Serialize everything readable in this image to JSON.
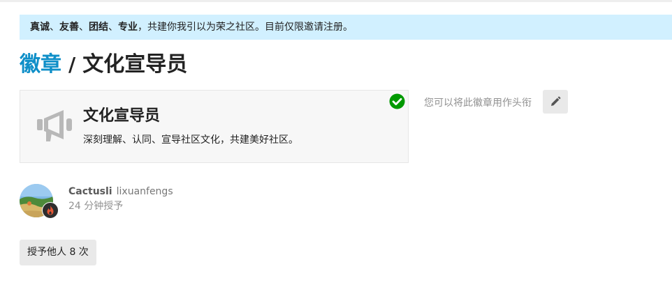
{
  "notice": {
    "values": [
      "真诚",
      "友善",
      "团结",
      "专业"
    ],
    "separator": "、",
    "suffix": "，共建你我引以为荣之社区。目前仅限邀请注册。"
  },
  "header": {
    "breadcrumb": "徽章",
    "separator": "/",
    "title": "文化宣导员"
  },
  "badge": {
    "name": "文化宣导员",
    "description": "深刻理解、认同、宣导社区文化，共建美好社区。",
    "icon": "megaphone-icon",
    "granted_indicator": "check-circle-icon",
    "title_hint": "您可以将此徽章用作头衔",
    "edit_icon": "pencil-icon"
  },
  "grant": {
    "username": "Cactusli",
    "fullname": "lixuanfengs",
    "granted_time": "24 分钟授予",
    "avatar": "user-avatar",
    "flair_icon": "flame-icon"
  },
  "grant_others_label": "授予他人 8 次",
  "colors": {
    "accent": "#0f8fc8",
    "notice_bg": "#d1f0ff",
    "success": "#009900",
    "button_bg": "#e9e9e9",
    "muted_text": "#919191"
  }
}
